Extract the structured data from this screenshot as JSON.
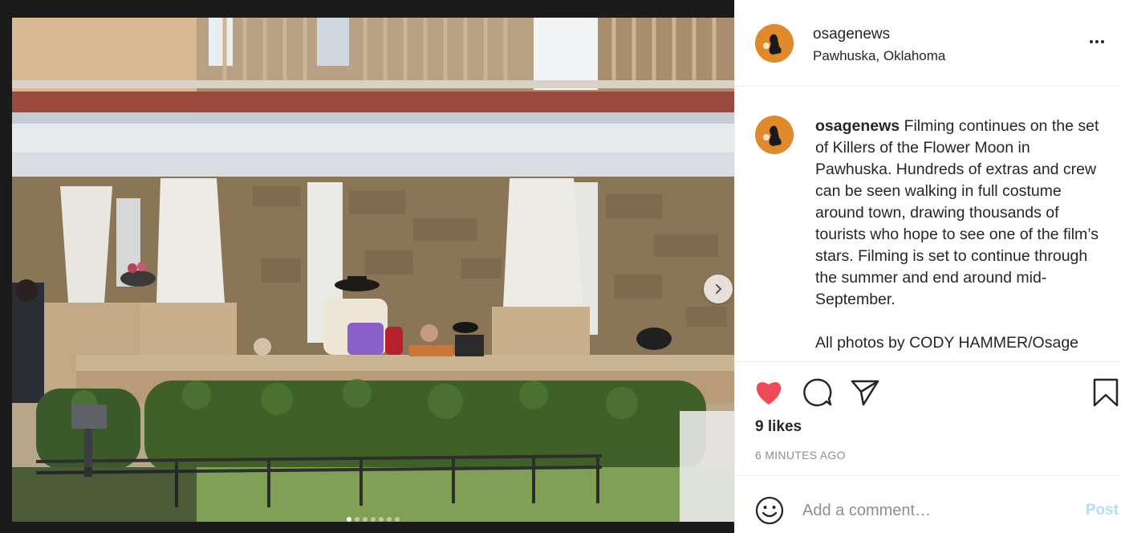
{
  "post": {
    "username": "osagenews",
    "location": "Pawhuska, Oklahoma",
    "caption_text": "Filming continues on the set of Killers of the Flower Moon in Pawhuska. Hundreds of extras and crew can be seen walking in full costume around town, drawing thousands of tourists who hope to see one of the film’s stars. Filming is set to continue through the summer and end around mid-September.",
    "caption_credit": "All photos by CODY HAMMER/Osage",
    "likes": "9 likes",
    "timestamp": "6 MINUTES AGO",
    "liked": true
  },
  "comment": {
    "placeholder": "Add a comment…",
    "post_label": "Post"
  },
  "carousel": {
    "total_slides": 7,
    "active_slide": 1
  },
  "icons": {
    "like": "heart-icon",
    "comment": "comment-icon",
    "share": "paper-plane-icon",
    "save": "bookmark-icon",
    "more": "more-options-icon",
    "next": "chevron-right-icon",
    "emoji": "smiley-icon"
  },
  "colors": {
    "like_red": "#ed4956",
    "avatar_orange": "#e38a2e",
    "post_button_disabled": "#b2dffc",
    "muted_text": "#8e8e8e"
  }
}
